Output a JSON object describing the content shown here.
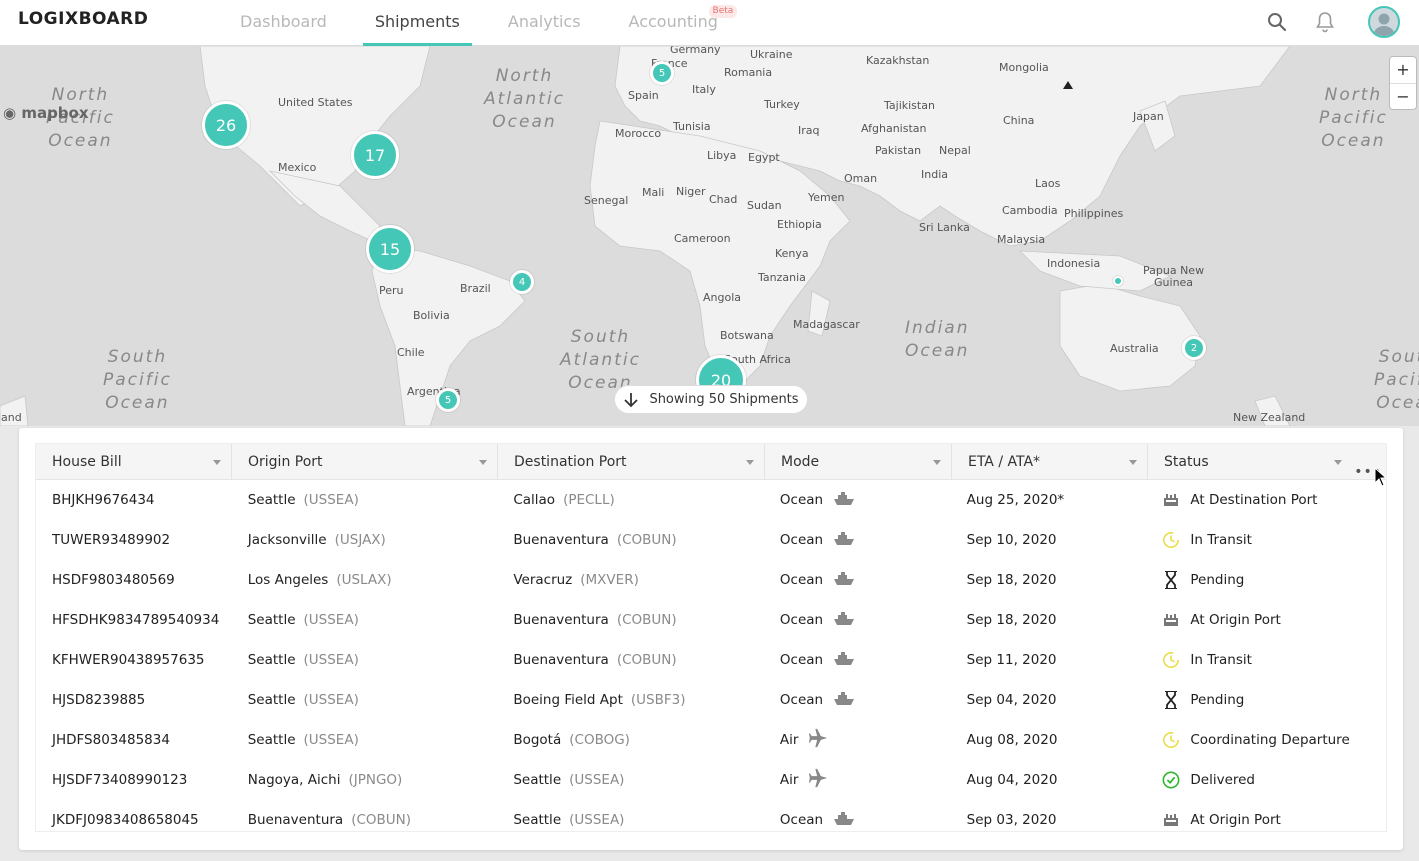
{
  "app": {
    "logo": "LOGIXBOARD"
  },
  "nav": {
    "items": [
      {
        "label": "Dashboard",
        "active": false
      },
      {
        "label": "Shipments",
        "active": true
      },
      {
        "label": "Analytics",
        "active": false
      },
      {
        "label": "Accounting",
        "active": false,
        "badge": "Beta"
      }
    ]
  },
  "header_icons": [
    "search-icon",
    "bell-icon",
    "avatar"
  ],
  "colors": {
    "accent": "#45c7b7",
    "map_land": "#f2f2f2",
    "map_water": "#dcdcdc",
    "transit_yellow": "#e8e04a",
    "delivered_green": "#2eb82e"
  },
  "map": {
    "attribution": "mapbox",
    "zoom_in": "+",
    "zoom_out": "−",
    "oceans": [
      "North\nPacific\nOcean",
      "North\nAtlantic\nOcean",
      "North\nPacific\nOcean",
      "South\nPacific\nOcean",
      "South\nAtlantic\nOcean",
      "Indian\nOcean",
      "South\nPacific\nOcean"
    ],
    "labels": [
      "Germany",
      "Ukraine",
      "Kazakhstan",
      "Mongolia",
      "France",
      "Romania",
      "Spain",
      "Italy",
      "Turkey",
      "Tajikistan",
      "United States",
      "Japan",
      "China",
      "Tunisia",
      "Iraq",
      "Afghanistan",
      "Morocco",
      "Libya",
      "Egypt",
      "Pakistan",
      "Nepal",
      "Mexico",
      "Oman",
      "India",
      "Mali",
      "Niger",
      "Chad",
      "Sudan",
      "Yemen",
      "Laos",
      "Senegal",
      "Cambodia",
      "Philippines",
      "Ethiopia",
      "Sri Lanka",
      "Cameroon",
      "Malaysia",
      "Kenya",
      "Indonesia",
      "Papua New\nGuinea",
      "Peru",
      "Brazil",
      "Tanzania",
      "Angola",
      "Madagascar",
      "Bolivia",
      "Botswana",
      "Australia",
      "Chile",
      "South Africa",
      "Argentina",
      "New Zealand",
      "land"
    ],
    "clusters": [
      "26",
      "17",
      "15",
      "5",
      "4",
      "20",
      "5",
      "2"
    ],
    "showing_label": "Showing 50 Shipments"
  },
  "table": {
    "columns": [
      "House Bill",
      "Origin Port",
      "Destination Port",
      "Mode",
      "ETA / ATA*",
      "Status"
    ],
    "more_label": "•••",
    "rows": [
      {
        "house_bill": "BHJKH9676434",
        "origin": "Seattle",
        "origin_code": "(USSEA)",
        "dest": "Callao",
        "dest_code": "(PECLL)",
        "mode": "Ocean",
        "mode_icon": "ship-icon",
        "eta": "Aug 25, 2020*",
        "status": "At Destination Port",
        "status_icon": "port-icon"
      },
      {
        "house_bill": "TUWER93489902",
        "origin": "Jacksonville",
        "origin_code": "(USJAX)",
        "dest": "Buenaventura",
        "dest_code": "(COBUN)",
        "mode": "Ocean",
        "mode_icon": "ship-icon",
        "eta": "Sep 10, 2020",
        "status": "In Transit",
        "status_icon": "clock-icon"
      },
      {
        "house_bill": "HSDF9803480569",
        "origin": "Los Angeles",
        "origin_code": "(USLAX)",
        "dest": "Veracruz",
        "dest_code": "(MXVER)",
        "mode": "Ocean",
        "mode_icon": "ship-icon",
        "eta": "Sep 18, 2020",
        "status": "Pending",
        "status_icon": "hourglass-icon"
      },
      {
        "house_bill": "HFSDHK9834789540934",
        "origin": "Seattle",
        "origin_code": "(USSEA)",
        "dest": "Buenaventura",
        "dest_code": "(COBUN)",
        "mode": "Ocean",
        "mode_icon": "ship-icon",
        "eta": "Sep 18, 2020",
        "status": "At Origin Port",
        "status_icon": "port-icon"
      },
      {
        "house_bill": "KFHWER90438957635",
        "origin": "Seattle",
        "origin_code": "(USSEA)",
        "dest": "Buenaventura",
        "dest_code": "(COBUN)",
        "mode": "Ocean",
        "mode_icon": "ship-icon",
        "eta": "Sep 11, 2020",
        "status": "In Transit",
        "status_icon": "clock-icon"
      },
      {
        "house_bill": "HJSD8239885",
        "origin": "Seattle",
        "origin_code": "(USSEA)",
        "dest": "Boeing Field Apt",
        "dest_code": "(USBF3)",
        "mode": "Ocean",
        "mode_icon": "ship-icon",
        "eta": "Sep 04, 2020",
        "status": "Pending",
        "status_icon": "hourglass-icon"
      },
      {
        "house_bill": "JHDFS803485834",
        "origin": "Seattle",
        "origin_code": "(USSEA)",
        "dest": "Bogotá",
        "dest_code": "(COBOG)",
        "mode": "Air",
        "mode_icon": "plane-icon",
        "eta": "Aug 08, 2020",
        "status": "Coordinating Departure",
        "status_icon": "clock-icon"
      },
      {
        "house_bill": "HJSDF73408990123",
        "origin": "Nagoya, Aichi",
        "origin_code": "(JPNGO)",
        "dest": "Seattle",
        "dest_code": "(USSEA)",
        "mode": "Air",
        "mode_icon": "plane-icon",
        "eta": "Aug 04, 2020",
        "status": "Delivered",
        "status_icon": "check-circle-icon"
      },
      {
        "house_bill": "JKDFJ0983408658045",
        "origin": "Buenaventura",
        "origin_code": "(COBUN)",
        "dest": "Seattle",
        "dest_code": "(USSEA)",
        "mode": "Ocean",
        "mode_icon": "ship-icon",
        "eta": "Sep 03, 2020",
        "status": "At Origin Port",
        "status_icon": "port-icon"
      }
    ]
  }
}
